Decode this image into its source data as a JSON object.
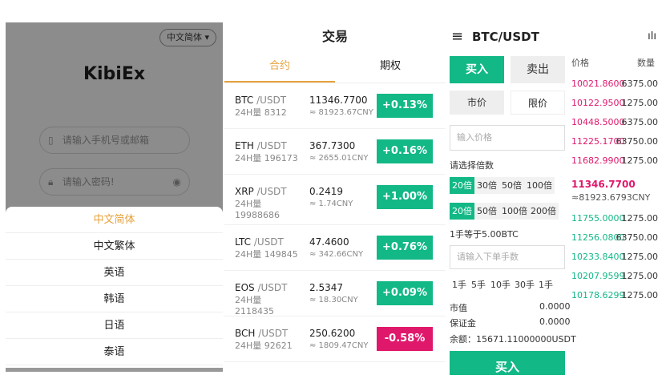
{
  "login": {
    "language_selector": "中文简体 ▾",
    "logo": "KibiEx",
    "phone_placeholder": "请输入手机号或邮箱",
    "password_placeholder": "请输入密码!",
    "language_options": [
      "中文简体",
      "中文繁体",
      "英语",
      "韩语",
      "日语",
      "泰语"
    ],
    "selected_language": "中文简体"
  },
  "market": {
    "title": "交易",
    "tabs": [
      "合约",
      "期权"
    ],
    "active_tab": "合约",
    "rows": [
      {
        "base": "BTC",
        "quote": " /USDT",
        "vol": "24H量 8312",
        "price": "11346.7700",
        "cny": "≈ 81923.67CNY",
        "change": "+0.13%",
        "dir": "up"
      },
      {
        "base": "ETH",
        "quote": " /USDT",
        "vol": "24H量 196173",
        "price": "367.7300",
        "cny": "≈ 2655.01CNY",
        "change": "+0.16%",
        "dir": "up"
      },
      {
        "base": "XRP",
        "quote": " /USDT",
        "vol": "24H量 19988686",
        "price": "0.2419",
        "cny": "≈ 1.74CNY",
        "change": "+1.00%",
        "dir": "up"
      },
      {
        "base": "LTC",
        "quote": " /USDT",
        "vol": "24H量 149845",
        "price": "47.4600",
        "cny": "≈ 342.66CNY",
        "change": "+0.76%",
        "dir": "up"
      },
      {
        "base": "EOS",
        "quote": " /USDT",
        "vol": "24H量 2118435",
        "price": "2.5347",
        "cny": "≈ 18.30CNY",
        "change": "+0.09%",
        "dir": "up"
      },
      {
        "base": "BCH",
        "quote": " /USDT",
        "vol": "24H量 92621",
        "price": "250.6200",
        "cny": "≈ 1809.47CNY",
        "change": "-0.58%",
        "dir": "dn"
      }
    ]
  },
  "trade": {
    "menu_icon": "≡",
    "pair": "BTC/USDT",
    "chart_icon": "ılı",
    "buy_tab": "买入",
    "sell_tab": "卖出",
    "market_price": "市价",
    "limit_price": "限价",
    "price_placeholder": "输入价格",
    "leverage_label": "请选择倍数",
    "leverage_row1": [
      "20倍",
      "30倍",
      "50倍",
      "100倍"
    ],
    "leverage_row2": [
      "20倍",
      "50倍",
      "100倍",
      "200倍"
    ],
    "lot_info": "1手等于5.00BTC",
    "lots_placeholder": "请输入下单手数",
    "lot_buttons": [
      "1手",
      "5手",
      "10手",
      "30手",
      "1手"
    ],
    "market_value_label": "市值",
    "market_value": "0.0000",
    "margin_label": "保证金",
    "margin": "0.0000",
    "balance": "余额：15671.11000000USDT",
    "buy_button": "买入",
    "book_price_header": "价格",
    "book_qty_header": "数量",
    "asks": [
      {
        "price": "10021.8600",
        "qty": "6375.00"
      },
      {
        "price": "10122.9500",
        "qty": "1275.00"
      },
      {
        "price": "10448.5000",
        "qty": "6375.00"
      },
      {
        "price": "11225.1700",
        "qty": "63750.00"
      },
      {
        "price": "11682.9900",
        "qty": "1275.00"
      }
    ],
    "last_price": "11346.7700",
    "last_cny": "≈81923.6793CNY",
    "bids": [
      {
        "price": "11755.0000",
        "qty": "1275.00"
      },
      {
        "price": "11256.0800",
        "qty": "63750.00"
      },
      {
        "price": "10233.8400",
        "qty": "1275.00"
      },
      {
        "price": "10207.9599",
        "qty": "1275.00"
      },
      {
        "price": "10178.6299",
        "qty": "1275.00"
      }
    ],
    "colors": {
      "green": "#12b886",
      "red": "#e0186c",
      "gold": "#e6a23c"
    }
  }
}
